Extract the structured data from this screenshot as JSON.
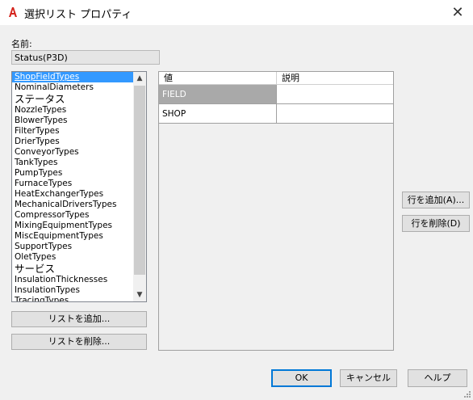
{
  "window": {
    "title": "選択リスト プロパティ",
    "close_glyph": "✕",
    "app_icon": "autocad-logo-icon",
    "accent_color": "#d4231c"
  },
  "name_field": {
    "label": "名前:",
    "value": "Status(P3D)"
  },
  "list": {
    "items": [
      "ShopFieldTypes",
      "NominalDiameters",
      "ステータス",
      "NozzleTypes",
      "BlowerTypes",
      "FilterTypes",
      "DrierTypes",
      "ConveyorTypes",
      "TankTypes",
      "PumpTypes",
      "FurnaceTypes",
      "HeatExchangerTypes",
      "MechanicalDriversTypes",
      "CompressorTypes",
      "MixingEquipmentTypes",
      "MiscEquipmentTypes",
      "SupportTypes",
      "OletTypes",
      "サービス",
      "InsulationThicknesses",
      "InsulationTypes",
      "TracingTypes"
    ],
    "selected_index": 0,
    "selection_color": "#3399ff",
    "scroll_up_glyph": "▲",
    "scroll_down_glyph": "▼"
  },
  "list_buttons": {
    "add": "リストを追加...",
    "delete": "リストを削除..."
  },
  "grid": {
    "columns": [
      "値",
      "説明"
    ],
    "rows": [
      {
        "value": "FIELD",
        "description": ""
      },
      {
        "value": "SHOP",
        "description": ""
      }
    ],
    "selected_row": 0,
    "selected_color": "#a9a9a9"
  },
  "row_buttons": {
    "add": "行を追加(A)...",
    "delete": "行を削除(D)"
  },
  "footer": {
    "ok": "OK",
    "cancel": "キャンセル",
    "help": "ヘルプ"
  }
}
